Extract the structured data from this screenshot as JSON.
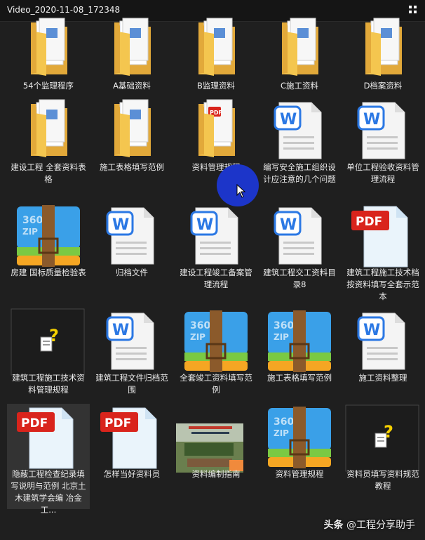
{
  "window": {
    "title": "Video_2020-11-08_172348"
  },
  "watermark": {
    "brand": "头条",
    "handle": "@工程分享助手"
  },
  "rows": [
    [
      {
        "name": "54个监理程序",
        "type": "folder"
      },
      {
        "name": "A基础资料",
        "type": "folder"
      },
      {
        "name": "B监理资料",
        "type": "folder"
      },
      {
        "name": "C施工资料",
        "type": "folder"
      },
      {
        "name": "D档案资料",
        "type": "folder"
      }
    ],
    [
      {
        "name": "建设工程 全套资料表格",
        "type": "folder"
      },
      {
        "name": "施工表格填写范例",
        "type": "folder"
      },
      {
        "name": "资料管理规程",
        "type": "folder-pdf"
      },
      {
        "name": "编写安全施工组织设计应注意的几个问题",
        "type": "word"
      },
      {
        "name": "单位工程验收资料管理流程",
        "type": "word"
      }
    ],
    [
      {
        "name": "房建 国标质量检验表",
        "type": "zip"
      },
      {
        "name": "归档文件",
        "type": "word"
      },
      {
        "name": "建设工程竣工备案管理流程",
        "type": "word"
      },
      {
        "name": "建筑工程交工资料目录8",
        "type": "word"
      },
      {
        "name": "建筑工程施工技术档按资料填写全套示范本",
        "type": "pdf"
      }
    ],
    [
      {
        "name": "建筑工程施工技术资料管理规程",
        "type": "unknown"
      },
      {
        "name": "建筑工程文件归档范围",
        "type": "word"
      },
      {
        "name": "全套竣工资料填写范例",
        "type": "zip"
      },
      {
        "name": "施工表格填写范例",
        "type": "zip"
      },
      {
        "name": "施工资料整理",
        "type": "word"
      }
    ],
    [
      {
        "name": "隐蔽工程检查纪录填写说明与范例 北京土木建筑学会编 冶金工...",
        "type": "pdf"
      },
      {
        "name": "怎样当好资料员",
        "type": "pdf"
      },
      {
        "name": "资料编制指南",
        "type": "image"
      },
      {
        "name": "资料管理规程",
        "type": "zip"
      },
      {
        "name": "资料员填写资料规范教程",
        "type": "unknown"
      }
    ]
  ],
  "colors": {
    "folder": "#f4c64f",
    "folder_dark": "#e2a93a",
    "word": "#2b78e4",
    "pdf": "#d9241c",
    "zip_blue": "#3aa0e8",
    "zip_green": "#7ac943",
    "zip_orange": "#f5a623",
    "strap": "#8b5a2b"
  }
}
